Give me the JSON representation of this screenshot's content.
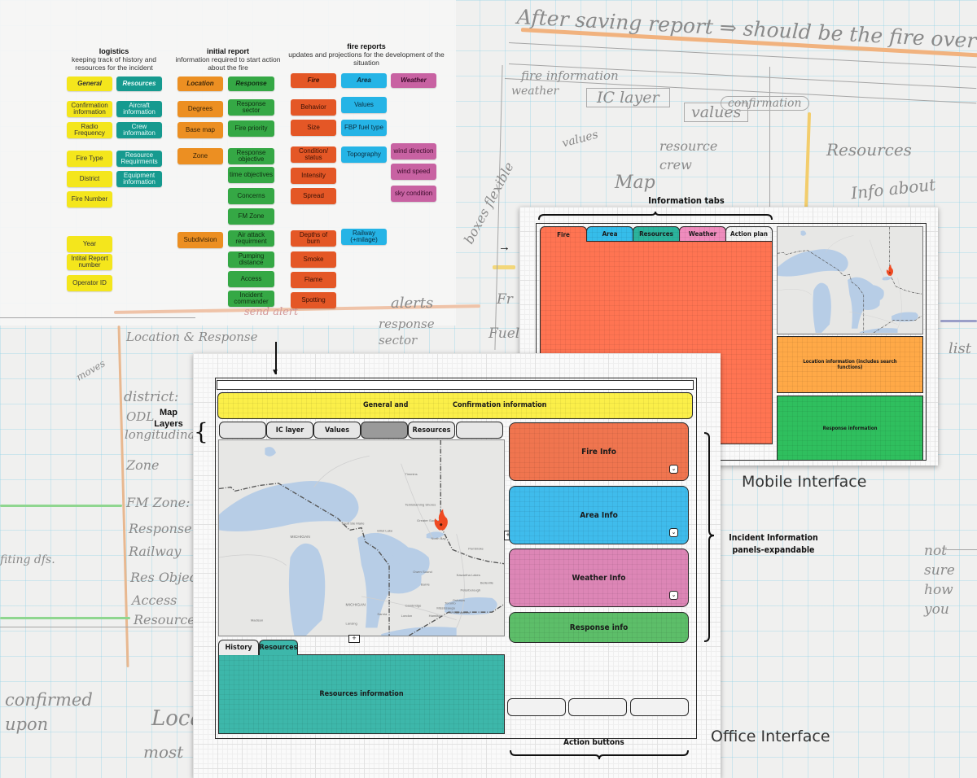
{
  "handwritten_notes": {
    "top_heading": "After saving report ⇒ should be the fire overview",
    "fire_information": "fire information",
    "tabs": [
      "weather",
      "IC layer",
      "values"
    ],
    "confirmation": "confirmation",
    "values": "values",
    "resource": "resource",
    "crew": "crew",
    "map": "Map",
    "resources": "Resources",
    "info_about": "Info about",
    "boxes_flexible": "boxes flexible",
    "fr": "Fr",
    "fuel": "Fuel",
    "list": "list",
    "not_sure": "not sure how you",
    "alerts": "alerts",
    "response_sector": "response sector",
    "send_alert": "send alert",
    "location_response": "Location & Response",
    "moves": "moves",
    "district": "district:",
    "odl": "ODL",
    "longitudinal": "longitudinal",
    "zone": "Zone",
    "fm_zone": "FM Zone:",
    "response_s": "Response s",
    "railway": "Railway",
    "res_objec": "Res Objec",
    "access": "Access",
    "resources_left": "Resources",
    "fighting_dfs": "fiting dfs.",
    "confirmed_upon": "confirmed upon",
    "location": "Locat",
    "most": "most"
  },
  "taxonomy": {
    "groups": [
      {
        "title": "logistics",
        "subtitle": "keeping track of history and resources for the incident",
        "columns": [
          {
            "header": "General",
            "color": "#f4e61c",
            "items": [
              "Confirmation information",
              "Radio Frequency",
              "Fire Type",
              "District",
              "Fire Number",
              "Year",
              "Intital Report number",
              "Operator ID"
            ]
          },
          {
            "header": "Resources",
            "color": "#169a8f",
            "items": [
              "Aircraft information",
              "Crew informaiton",
              "Resource Requirments",
              "Equipment information"
            ]
          }
        ]
      },
      {
        "title": "initial report",
        "subtitle": "information required to start action about the fire",
        "columns": [
          {
            "header": "Location",
            "color": "#ec8f22",
            "items": [
              "Degrees",
              "Base map",
              "Zone",
              "Subdivision"
            ]
          },
          {
            "header": "Response",
            "color": "#35a845",
            "items": [
              "Response sector",
              "Fire priority",
              "Response objective",
              "time objectives",
              "Concerns",
              "FM Zone",
              "Air attack requirment",
              "Pumping distance",
              "Access",
              "Incident commander"
            ]
          }
        ]
      },
      {
        "title": "fire reports",
        "subtitle": "updates and projections for the development of the situation",
        "columns": [
          {
            "header": "Fire",
            "color": "#e45726",
            "items": [
              "Behavior",
              "Size",
              "Condition/ status",
              "Intensity",
              "Spread",
              "Depths of burn",
              "Smoke",
              "Flame",
              "Spotting"
            ]
          },
          {
            "header": "Area",
            "color": "#25b4e6",
            "items": [
              "Values",
              "FBP fuel type",
              "Topography",
              "Railway (+milage)"
            ]
          },
          {
            "header": "Weather",
            "color": "#c862a2",
            "items": [
              "wind direction",
              "wind speed",
              "sky condition"
            ]
          }
        ]
      }
    ]
  },
  "mobile": {
    "caption": "Mobile Interface",
    "annotation": "Information tabs",
    "tabs": [
      {
        "label": "Fire",
        "color": "#ff7452"
      },
      {
        "label": "Area",
        "color": "#35bdea"
      },
      {
        "label": "Resources",
        "color": "#2bb39c"
      },
      {
        "label": "Weather",
        "color": "#ef8cbd"
      },
      {
        "label": "Action plan",
        "color": "#f2f2f2"
      }
    ],
    "location_panel": "Location information (includes search functions)",
    "response_panel": "Response information"
  },
  "office": {
    "caption": "Office Interface",
    "header_left": "General and",
    "header_right": "Confirmation information",
    "map_layers_annotation": "Map Layers",
    "layer_tabs": [
      "",
      "IC layer",
      "Values",
      "",
      "Resources",
      ""
    ],
    "panels": [
      {
        "label": "Fire Info",
        "color": "#f0754f",
        "expandable": true
      },
      {
        "label": "Area Info",
        "color": "#3fbcec",
        "expandable": true
      },
      {
        "label": "Weather Info",
        "color": "#dd86b6",
        "expandable": true
      },
      {
        "label": "Response info",
        "color": "#5dbe69",
        "expandable": false
      }
    ],
    "panels_annotation": "Incident Information panels-expandable",
    "bottom_tabs": [
      "History",
      "Resources"
    ],
    "resources_panel": "Resources information",
    "action_buttons_annotation": "Action buttons",
    "action_buttons": [
      "",
      "",
      ""
    ]
  },
  "map_labels": {
    "michigan_1": "MICHIGAN",
    "michigan_2": "MICHIGAN",
    "timmins": "Timmins",
    "temiskaming": "Temiskaming Shores",
    "sudbury": "Greater Sudbury",
    "elliot_lake": "Elliot Lake",
    "sault": "Sault Ste Marie",
    "north_bay": "North Bay",
    "pembroke": "Pembroke",
    "owen_sound": "Owen Sound",
    "barrie": "Barrie",
    "kawartha": "Kawartha Lakes",
    "belleville": "Belleville",
    "peterborough": "Peterborough",
    "oshawa": "Oshawa",
    "toronto": "Toronto",
    "mississauga": "Mississauga",
    "cambridge": "Cambridge",
    "hamilton": "Hamilton",
    "st_catharines": "St. Catharines",
    "london": "London",
    "sarnia": "Sarnia",
    "lansing": "Lansing",
    "madison": "Madison"
  },
  "colors": {
    "fire_marker": "#ef4b23"
  }
}
